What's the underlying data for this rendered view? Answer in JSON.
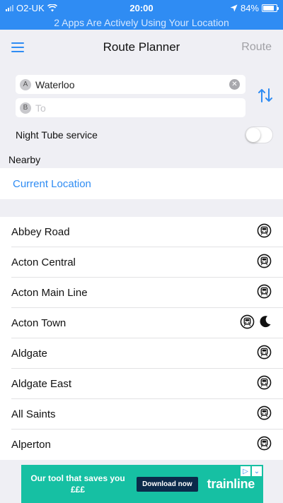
{
  "status": {
    "carrier": "O2-UK",
    "time": "20:00",
    "battery": "84%",
    "battery_level": 0.84,
    "location_banner": "2 Apps Are Actively Using Your Location"
  },
  "nav": {
    "title": "Route Planner",
    "route_label": "Route"
  },
  "inputs": {
    "from_marker": "A",
    "from_value": "Waterloo",
    "to_marker": "B",
    "to_placeholder": "To"
  },
  "night_tube": {
    "label": "Night Tube service",
    "enabled": false
  },
  "nearby": {
    "label": "Nearby",
    "current_location": "Current Location"
  },
  "stations": [
    {
      "name": "Abbey Road",
      "night": false
    },
    {
      "name": "Acton Central",
      "night": false
    },
    {
      "name": "Acton Main Line",
      "night": false
    },
    {
      "name": "Acton Town",
      "night": true
    },
    {
      "name": "Aldgate",
      "night": false
    },
    {
      "name": "Aldgate East",
      "night": false
    },
    {
      "name": "All Saints",
      "night": false
    },
    {
      "name": "Alperton",
      "night": false
    }
  ],
  "ad": {
    "tagline": "Our tool that saves you £££",
    "button": "Download now",
    "brand": "trainline"
  },
  "colors": {
    "accent": "#2f8cf3",
    "ad_background": "#16c0a3"
  }
}
